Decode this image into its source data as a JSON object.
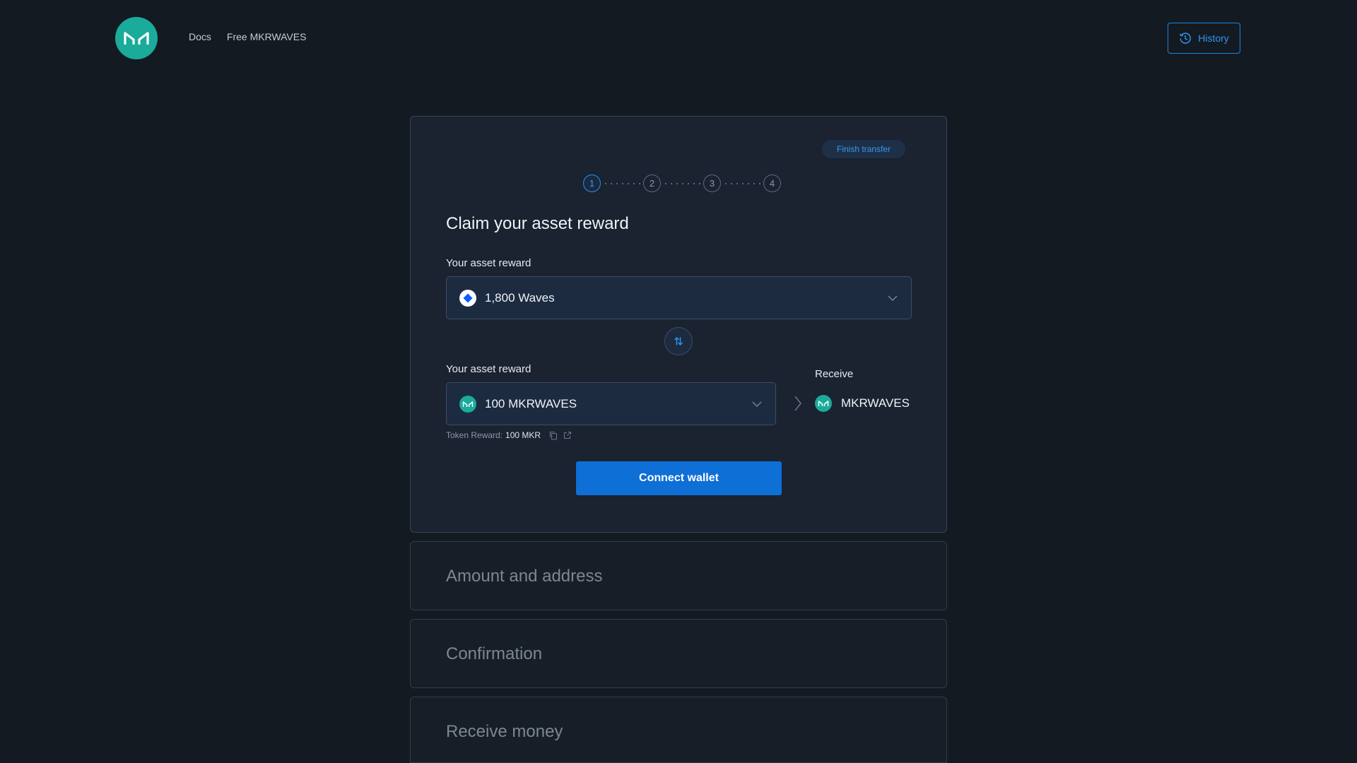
{
  "header": {
    "logo_icon": "maker-logo-icon",
    "nav": [
      {
        "label": "Docs"
      },
      {
        "label": "Free MKRWAVES"
      }
    ],
    "history_label": "History",
    "history_icon": "history-clock-icon"
  },
  "card": {
    "finish_label": "Finish transfer",
    "steps": [
      "1",
      "2",
      "3",
      "4"
    ],
    "active_step": 1,
    "title": "Claim your asset reward",
    "from": {
      "label": "Your asset reward",
      "value": "1,800 Waves",
      "icon": "waves-coin-icon"
    },
    "to": {
      "label": "Your asset reward",
      "value": "100 MKRWAVES",
      "icon": "mkr-coin-icon"
    },
    "receive": {
      "label": "Receive",
      "asset": "MKRWAVES"
    },
    "token_reward": {
      "label": "Token Reward:",
      "value": "100 MKR"
    },
    "connect_label": "Connect wallet"
  },
  "sections": [
    {
      "title": "Amount and address"
    },
    {
      "title": "Confirmation"
    },
    {
      "title": "Receive money"
    }
  ],
  "colors": {
    "background": "#141a22",
    "card": "#1b2230",
    "accent": "#0e6fd6",
    "brand_teal": "#1aab9b"
  }
}
